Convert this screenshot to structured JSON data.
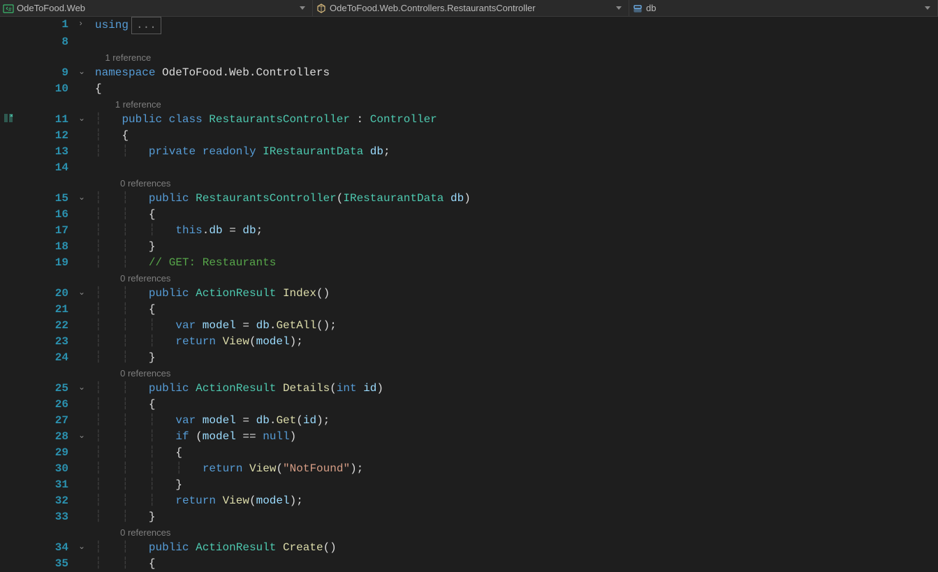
{
  "nav": {
    "project": "OdeToFood.Web",
    "class": "OdeToFood.Web.Controllers.RestaurantsController",
    "member": "db"
  },
  "lens": {
    "class": "1 reference",
    "ctor": "0 references",
    "index": "0 references",
    "details": "0 references",
    "create": "0 references"
  },
  "lines": [
    {
      "n": 1,
      "fold": "›",
      "tokens": [
        [
          "kw",
          "using"
        ],
        [
          "coll",
          "..."
        ]
      ]
    },
    {
      "n": 8,
      "fold": "",
      "tokens": []
    },
    {
      "lens": "class",
      "indent": 4
    },
    {
      "n": 9,
      "fold": "⌄",
      "tokens": [
        [
          "kw",
          "namespace"
        ],
        [
          "sp",
          " "
        ],
        [
          "punc",
          "OdeToFood.Web.Controllers"
        ]
      ]
    },
    {
      "n": 10,
      "fold": "",
      "tokens": [
        [
          "punc",
          "{"
        ]
      ]
    },
    {
      "lens": "class",
      "indent": 8,
      "which": "class"
    },
    {
      "n": 11,
      "fold": "⌄",
      "tokens": [
        [
          "ig",
          "    "
        ],
        [
          "kw",
          "public"
        ],
        [
          "sp",
          " "
        ],
        [
          "kw",
          "class"
        ],
        [
          "sp",
          " "
        ],
        [
          "type",
          "RestaurantsController"
        ],
        [
          "sp",
          " "
        ],
        [
          "punc",
          ":"
        ],
        [
          "sp",
          " "
        ],
        [
          "type",
          "Controller"
        ]
      ]
    },
    {
      "n": 12,
      "fold": "",
      "tokens": [
        [
          "ig",
          "    "
        ],
        [
          "punc",
          "{"
        ]
      ]
    },
    {
      "n": 13,
      "fold": "",
      "tokens": [
        [
          "ig",
          "        "
        ],
        [
          "kw",
          "private"
        ],
        [
          "sp",
          " "
        ],
        [
          "kw",
          "readonly"
        ],
        [
          "sp",
          " "
        ],
        [
          "type",
          "IRestaurantData"
        ],
        [
          "sp",
          " "
        ],
        [
          "var",
          "db"
        ],
        [
          "punc",
          ";"
        ]
      ]
    },
    {
      "n": 14,
      "fold": "",
      "tokens": []
    },
    {
      "lens": "ctor",
      "indent": 10
    },
    {
      "n": 15,
      "fold": "⌄",
      "tokens": [
        [
          "ig",
          "        "
        ],
        [
          "kw",
          "public"
        ],
        [
          "sp",
          " "
        ],
        [
          "type",
          "RestaurantsController"
        ],
        [
          "punc",
          "("
        ],
        [
          "type",
          "IRestaurantData"
        ],
        [
          "sp",
          " "
        ],
        [
          "var",
          "db"
        ],
        [
          "punc",
          ")"
        ]
      ]
    },
    {
      "n": 16,
      "fold": "",
      "tokens": [
        [
          "ig",
          "        "
        ],
        [
          "punc",
          "{"
        ]
      ]
    },
    {
      "n": 17,
      "fold": "",
      "tokens": [
        [
          "ig",
          "            "
        ],
        [
          "kw",
          "this"
        ],
        [
          "punc",
          "."
        ],
        [
          "var",
          "db"
        ],
        [
          "sp",
          " "
        ],
        [
          "punc",
          "="
        ],
        [
          "sp",
          " "
        ],
        [
          "var",
          "db"
        ],
        [
          "punc",
          ";"
        ]
      ]
    },
    {
      "n": 18,
      "fold": "",
      "tokens": [
        [
          "ig",
          "        "
        ],
        [
          "punc",
          "}"
        ]
      ]
    },
    {
      "n": 19,
      "fold": "",
      "tokens": [
        [
          "ig",
          "        "
        ],
        [
          "cmt",
          "// GET: Restaurants"
        ]
      ]
    },
    {
      "lens": "index",
      "indent": 10
    },
    {
      "n": 20,
      "fold": "⌄",
      "tokens": [
        [
          "ig",
          "        "
        ],
        [
          "kw",
          "public"
        ],
        [
          "sp",
          " "
        ],
        [
          "type",
          "ActionResult"
        ],
        [
          "sp",
          " "
        ],
        [
          "mth",
          "Index"
        ],
        [
          "punc",
          "()"
        ]
      ]
    },
    {
      "n": 21,
      "fold": "",
      "tokens": [
        [
          "ig",
          "        "
        ],
        [
          "punc",
          "{"
        ]
      ]
    },
    {
      "n": 22,
      "fold": "",
      "tokens": [
        [
          "ig",
          "            "
        ],
        [
          "kw",
          "var"
        ],
        [
          "sp",
          " "
        ],
        [
          "var",
          "model"
        ],
        [
          "sp",
          " "
        ],
        [
          "punc",
          "="
        ],
        [
          "sp",
          " "
        ],
        [
          "var",
          "db"
        ],
        [
          "punc",
          "."
        ],
        [
          "mth",
          "GetAll"
        ],
        [
          "punc",
          "();"
        ]
      ]
    },
    {
      "n": 23,
      "fold": "",
      "tokens": [
        [
          "ig",
          "            "
        ],
        [
          "kw",
          "return"
        ],
        [
          "sp",
          " "
        ],
        [
          "mth",
          "View"
        ],
        [
          "punc",
          "("
        ],
        [
          "var",
          "model"
        ],
        [
          "punc",
          ");"
        ]
      ]
    },
    {
      "n": 24,
      "fold": "",
      "tokens": [
        [
          "ig",
          "        "
        ],
        [
          "punc",
          "}"
        ]
      ]
    },
    {
      "lens": "details",
      "indent": 10
    },
    {
      "n": 25,
      "fold": "⌄",
      "tokens": [
        [
          "ig",
          "        "
        ],
        [
          "kw",
          "public"
        ],
        [
          "sp",
          " "
        ],
        [
          "type",
          "ActionResult"
        ],
        [
          "sp",
          " "
        ],
        [
          "mth",
          "Details"
        ],
        [
          "punc",
          "("
        ],
        [
          "kw",
          "int"
        ],
        [
          "sp",
          " "
        ],
        [
          "var",
          "id"
        ],
        [
          "punc",
          ")"
        ]
      ]
    },
    {
      "n": 26,
      "fold": "",
      "tokens": [
        [
          "ig",
          "        "
        ],
        [
          "punc",
          "{"
        ]
      ]
    },
    {
      "n": 27,
      "fold": "",
      "tokens": [
        [
          "ig",
          "            "
        ],
        [
          "kw",
          "var"
        ],
        [
          "sp",
          " "
        ],
        [
          "var",
          "model"
        ],
        [
          "sp",
          " "
        ],
        [
          "punc",
          "="
        ],
        [
          "sp",
          " "
        ],
        [
          "var",
          "db"
        ],
        [
          "punc",
          "."
        ],
        [
          "mth",
          "Get"
        ],
        [
          "punc",
          "("
        ],
        [
          "var",
          "id"
        ],
        [
          "punc",
          ");"
        ]
      ]
    },
    {
      "n": 28,
      "fold": "⌄",
      "tokens": [
        [
          "ig",
          "            "
        ],
        [
          "kw",
          "if"
        ],
        [
          "sp",
          " "
        ],
        [
          "punc",
          "("
        ],
        [
          "var",
          "model"
        ],
        [
          "sp",
          " "
        ],
        [
          "punc",
          "=="
        ],
        [
          "sp",
          " "
        ],
        [
          "kw",
          "null"
        ],
        [
          "punc",
          ")"
        ]
      ]
    },
    {
      "n": 29,
      "fold": "",
      "tokens": [
        [
          "ig",
          "            "
        ],
        [
          "punc",
          "{"
        ]
      ]
    },
    {
      "n": 30,
      "fold": "",
      "tokens": [
        [
          "ig",
          "                "
        ],
        [
          "kw",
          "return"
        ],
        [
          "sp",
          " "
        ],
        [
          "mth",
          "View"
        ],
        [
          "punc",
          "("
        ],
        [
          "str",
          "\"NotFound\""
        ],
        [
          "punc",
          ");"
        ]
      ]
    },
    {
      "n": 31,
      "fold": "",
      "tokens": [
        [
          "ig",
          "            "
        ],
        [
          "punc",
          "}"
        ]
      ]
    },
    {
      "n": 32,
      "fold": "",
      "tokens": [
        [
          "ig",
          "            "
        ],
        [
          "kw",
          "return"
        ],
        [
          "sp",
          " "
        ],
        [
          "mth",
          "View"
        ],
        [
          "punc",
          "("
        ],
        [
          "var",
          "model"
        ],
        [
          "punc",
          ");"
        ]
      ]
    },
    {
      "n": 33,
      "fold": "",
      "tokens": [
        [
          "ig",
          "        "
        ],
        [
          "punc",
          "}"
        ]
      ]
    },
    {
      "lens": "create",
      "indent": 10
    },
    {
      "n": 34,
      "fold": "⌄",
      "tokens": [
        [
          "ig",
          "        "
        ],
        [
          "kw",
          "public"
        ],
        [
          "sp",
          " "
        ],
        [
          "type",
          "ActionResult"
        ],
        [
          "sp",
          " "
        ],
        [
          "mth",
          "Create"
        ],
        [
          "punc",
          "()"
        ]
      ]
    },
    {
      "n": 35,
      "fold": "",
      "tokens": [
        [
          "ig",
          "        "
        ],
        [
          "punc",
          "{"
        ]
      ]
    }
  ],
  "margin_icon_line": 11
}
